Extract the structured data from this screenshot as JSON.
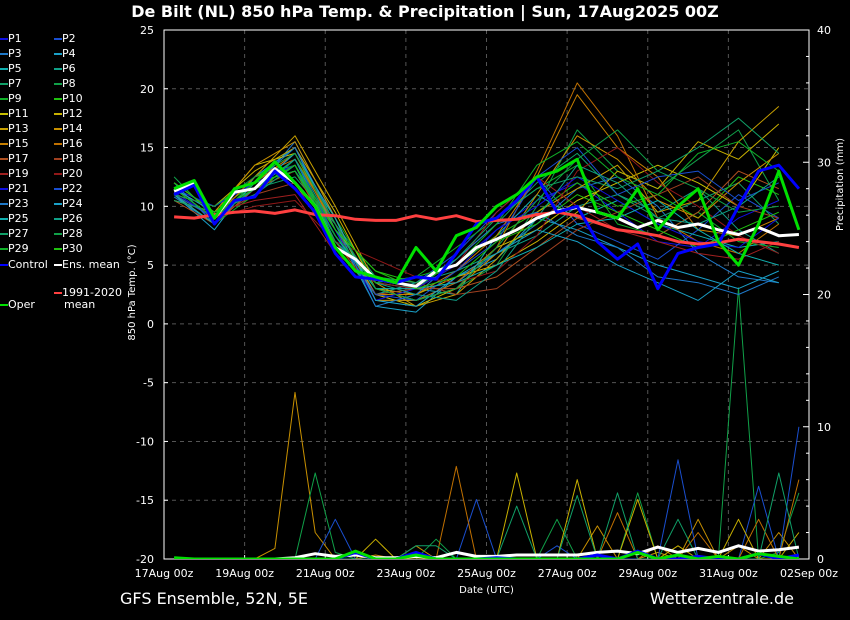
{
  "title": "De Bilt  (NL)  850 hPa Temp. & Precipitation | Sun, 17Aug2025 00Z",
  "footer": {
    "left": "GFS Ensemble, 52N, 5E",
    "right": "Wetterzentrale.de"
  },
  "chart_data": {
    "type": "line",
    "title": "De Bilt  (NL)  850 hPa Temp. & Precipitation | Sun, 17Aug2025 00Z",
    "xlabel": "Date (UTC)",
    "ylabel": "850 hPa Temp. (°C)",
    "y2label": "Precipitation (mm)",
    "ylim": [
      -20,
      25
    ],
    "y2lim": [
      0,
      40
    ],
    "yticks": [
      "25",
      "20",
      "15",
      "10",
      "5",
      "0",
      "-5",
      "-10",
      "-15",
      "-20"
    ],
    "y2ticks": [
      "40",
      "30",
      "20",
      "10",
      "0"
    ],
    "xticks": [
      "17Aug 00z",
      "19Aug 00z",
      "21Aug 00z",
      "23Aug 00z",
      "25Aug 00z",
      "27Aug 00z",
      "29Aug 00z",
      "31Aug 00z",
      "02Sep 00z"
    ],
    "grid": true,
    "legend_position": "left-outside",
    "x_start": "17Aug2025 06z",
    "main_step_hours": 12,
    "member_step_hours": 24,
    "colors": {
      "control": "#0000ff",
      "mean": "#ffffff",
      "oper": "#00e000",
      "climate": "#ff4040",
      "axis": "#ffffff",
      "grid": "#555555"
    },
    "main_series": [
      {
        "key": "climate",
        "name": "1991-2020 mean",
        "color": "#ff4040",
        "values": [
          9.1,
          9.0,
          9.3,
          9.5,
          9.6,
          9.4,
          9.7,
          9.3,
          9.2,
          8.9,
          8.8,
          8.8,
          9.2,
          8.9,
          9.2,
          8.7,
          8.8,
          8.9,
          9.3,
          9.5,
          9.2,
          8.6,
          8.0,
          7.8,
          7.5,
          7.0,
          6.8,
          6.9,
          7.2,
          7.0,
          6.8,
          6.5
        ]
      },
      {
        "key": "mean",
        "name": "Ens. mean",
        "color": "#ffffff",
        "values": [
          11.3,
          12.0,
          9.0,
          11.2,
          11.5,
          13.2,
          12.0,
          10.0,
          6.5,
          5.5,
          3.8,
          3.5,
          3.2,
          4.5,
          5.0,
          6.5,
          7.2,
          8.0,
          9.0,
          9.6,
          9.9,
          9.5,
          9.0,
          8.2,
          8.8,
          8.2,
          8.5,
          8.0,
          7.6,
          8.2,
          7.5,
          7.6
        ]
      },
      {
        "key": "control",
        "name": "Control",
        "color": "#0000ff",
        "values": [
          11.0,
          11.8,
          8.5,
          10.5,
          10.8,
          13.0,
          11.5,
          9.5,
          6.0,
          4.0,
          3.8,
          3.5,
          4.0,
          3.8,
          6.0,
          8.5,
          9.0,
          10.5,
          12.5,
          9.5,
          10.0,
          7.0,
          5.5,
          6.8,
          3.0,
          6.0,
          6.5,
          6.8,
          10.0,
          13.0,
          13.5,
          11.5
        ]
      },
      {
        "key": "oper",
        "name": "Oper",
        "color": "#00e000",
        "values": [
          11.5,
          12.2,
          9.0,
          11.5,
          12.0,
          13.8,
          12.0,
          10.0,
          6.5,
          4.5,
          4.0,
          3.5,
          6.5,
          4.5,
          7.5,
          8.2,
          10.0,
          11.0,
          12.5,
          13.0,
          14.0,
          9.5,
          9.0,
          11.5,
          8.0,
          10.0,
          11.5,
          7.0,
          5.0,
          8.5,
          13.0,
          8.0
        ]
      }
    ],
    "members": [
      {
        "name": "P1",
        "color": "#1010e0",
        "values": [
          11.2,
          9.0,
          11.0,
          13.5,
          7.5,
          3.0,
          2.5,
          4.5,
          8.0,
          10.5,
          12.0,
          9.5,
          7.0,
          6.5,
          9.0,
          10.5
        ]
      },
      {
        "name": "P2",
        "color": "#1a4fd0",
        "values": [
          11.5,
          9.5,
          12.0,
          13.0,
          8.5,
          2.5,
          3.5,
          6.0,
          9.5,
          12.5,
          8.5,
          7.0,
          5.5,
          8.0,
          11.0,
          9.0
        ]
      },
      {
        "name": "P3",
        "color": "#1e78c8",
        "values": [
          10.8,
          8.5,
          11.5,
          15.5,
          9.0,
          2.0,
          2.0,
          3.5,
          6.0,
          8.5,
          11.5,
          12.5,
          10.0,
          6.0,
          4.0,
          3.5
        ]
      },
      {
        "name": "P4",
        "color": "#1aa0c8",
        "values": [
          11.0,
          8.0,
          12.5,
          15.0,
          8.0,
          1.5,
          1.0,
          4.0,
          5.5,
          9.0,
          8.0,
          6.5,
          5.0,
          4.0,
          3.0,
          4.5
        ]
      },
      {
        "name": "P5",
        "color": "#10b0b0",
        "values": [
          12.0,
          9.5,
          11.0,
          14.0,
          7.0,
          3.5,
          3.0,
          2.5,
          7.5,
          11.0,
          9.0,
          10.5,
          8.5,
          7.5,
          6.5,
          7.0
        ]
      },
      {
        "name": "P6",
        "color": "#10a088",
        "values": [
          11.5,
          10.0,
          12.0,
          13.5,
          6.5,
          2.5,
          3.5,
          4.5,
          6.0,
          7.5,
          10.0,
          11.0,
          9.5,
          11.5,
          8.0,
          6.0
        ]
      },
      {
        "name": "P7",
        "color": "#10a068",
        "values": [
          11.0,
          9.0,
          11.5,
          12.5,
          8.5,
          4.0,
          3.0,
          5.5,
          8.5,
          12.0,
          14.5,
          11.0,
          9.0,
          10.5,
          12.0,
          8.5
        ]
      },
      {
        "name": "P8",
        "color": "#10a048",
        "values": [
          12.5,
          9.0,
          12.5,
          13.5,
          7.5,
          3.0,
          2.0,
          3.0,
          5.0,
          10.0,
          16.5,
          13.0,
          11.5,
          14.0,
          16.5,
          10.5
        ]
      },
      {
        "name": "P9",
        "color": "#10b028",
        "values": [
          11.0,
          8.5,
          11.0,
          14.0,
          9.0,
          3.5,
          4.0,
          6.5,
          9.0,
          11.5,
          13.5,
          8.5,
          7.5,
          9.5,
          7.0,
          6.5
        ]
      },
      {
        "name": "P10",
        "color": "#20c010",
        "values": [
          11.5,
          9.5,
          12.0,
          13.0,
          8.0,
          4.5,
          3.5,
          5.0,
          7.5,
          9.5,
          12.0,
          10.0,
          11.0,
          9.0,
          12.5,
          11.0
        ]
      },
      {
        "name": "P11",
        "color": "#c8c000",
        "values": [
          10.5,
          9.5,
          13.5,
          14.5,
          8.5,
          2.5,
          1.5,
          3.0,
          6.5,
          8.0,
          10.5,
          12.0,
          13.5,
          12.0,
          10.0,
          15.0
        ]
      },
      {
        "name": "P12",
        "color": "#c8b000",
        "values": [
          11.0,
          10.0,
          13.0,
          15.0,
          9.5,
          3.0,
          2.5,
          4.0,
          5.0,
          7.0,
          9.5,
          13.0,
          11.5,
          15.5,
          14.0,
          17.0
        ]
      },
      {
        "name": "P13",
        "color": "#c8a000",
        "values": [
          11.5,
          9.0,
          12.5,
          16.0,
          10.0,
          3.5,
          1.5,
          2.5,
          5.5,
          9.5,
          11.5,
          13.5,
          9.5,
          10.5,
          15.5,
          18.5
        ]
      },
      {
        "name": "P14",
        "color": "#c89000",
        "values": [
          12.0,
          9.5,
          13.5,
          15.5,
          9.0,
          2.0,
          2.0,
          3.0,
          6.0,
          11.0,
          16.0,
          14.0,
          10.5,
          9.0,
          12.0,
          14.5
        ]
      },
      {
        "name": "P15",
        "color": "#c88000",
        "values": [
          11.0,
          8.5,
          12.0,
          14.5,
          8.0,
          2.5,
          2.5,
          4.5,
          7.5,
          12.5,
          19.5,
          15.0,
          12.5,
          8.0,
          7.5,
          9.0
        ]
      },
      {
        "name": "P16",
        "color": "#c07000",
        "values": [
          11.5,
          9.0,
          12.5,
          14.0,
          8.5,
          3.0,
          2.0,
          3.5,
          6.5,
          13.0,
          20.5,
          16.0,
          9.0,
          7.0,
          6.0,
          8.5
        ]
      },
      {
        "name": "P17",
        "color": "#b05020",
        "values": [
          10.5,
          8.5,
          11.5,
          13.0,
          7.0,
          2.5,
          3.0,
          3.0,
          4.0,
          6.5,
          9.0,
          8.0,
          7.5,
          9.5,
          13.0,
          11.5
        ]
      },
      {
        "name": "P18",
        "color": "#a04020",
        "values": [
          11.0,
          9.0,
          11.0,
          12.0,
          6.5,
          4.0,
          3.5,
          2.5,
          3.0,
          5.5,
          8.0,
          9.5,
          11.0,
          12.5,
          10.0,
          9.0
        ]
      },
      {
        "name": "P19",
        "color": "#a02020",
        "values": [
          11.5,
          9.5,
          10.5,
          11.0,
          6.0,
          3.5,
          3.0,
          5.0,
          9.5,
          12.5,
          10.0,
          8.0,
          7.0,
          6.0,
          5.5,
          7.0
        ]
      },
      {
        "name": "P20",
        "color": "#901818",
        "values": [
          11.0,
          9.0,
          10.0,
          10.5,
          7.0,
          5.5,
          4.0,
          3.5,
          4.5,
          7.5,
          13.0,
          15.0,
          12.0,
          10.0,
          7.5,
          6.0
        ]
      },
      {
        "name": "P21",
        "color": "#1010e0",
        "values": [
          11.5,
          10.0,
          12.0,
          13.5,
          8.0,
          2.0,
          3.0,
          5.0,
          8.0,
          10.0,
          12.5,
          10.5,
          8.5,
          7.0,
          6.5,
          9.0
        ]
      },
      {
        "name": "P22",
        "color": "#1a4fd0",
        "values": [
          11.0,
          9.0,
          11.5,
          14.0,
          7.5,
          2.5,
          2.0,
          4.5,
          7.0,
          12.5,
          15.0,
          11.0,
          12.5,
          13.0,
          10.5,
          12.0
        ]
      },
      {
        "name": "P23",
        "color": "#1e78c8",
        "values": [
          12.0,
          8.5,
          12.0,
          15.0,
          8.5,
          1.5,
          2.5,
          5.5,
          8.5,
          9.5,
          7.5,
          6.5,
          4.0,
          3.5,
          2.5,
          4.0
        ]
      },
      {
        "name": "P24",
        "color": "#1aa0c8",
        "values": [
          11.5,
          9.5,
          11.5,
          14.5,
          9.0,
          2.0,
          1.5,
          4.0,
          6.0,
          8.0,
          7.0,
          5.0,
          3.5,
          2.0,
          4.5,
          3.5
        ]
      },
      {
        "name": "P25",
        "color": "#10b0b0",
        "values": [
          11.0,
          8.5,
          12.0,
          13.0,
          7.5,
          3.0,
          3.0,
          3.5,
          5.0,
          6.5,
          8.5,
          9.0,
          10.5,
          8.0,
          6.0,
          5.0
        ]
      },
      {
        "name": "P26",
        "color": "#10a088",
        "values": [
          11.5,
          9.0,
          11.5,
          14.0,
          8.0,
          3.5,
          2.5,
          2.0,
          4.5,
          9.0,
          13.5,
          12.0,
          9.0,
          8.5,
          10.0,
          12.5
        ]
      },
      {
        "name": "P27",
        "color": "#10a068",
        "values": [
          10.5,
          9.5,
          11.0,
          13.5,
          7.0,
          4.0,
          3.5,
          5.5,
          9.0,
          11.5,
          12.5,
          11.5,
          13.0,
          15.0,
          17.5,
          14.5
        ]
      },
      {
        "name": "P28",
        "color": "#10a048",
        "values": [
          11.0,
          10.0,
          12.5,
          14.5,
          8.5,
          3.0,
          2.0,
          3.0,
          6.5,
          10.5,
          14.0,
          16.5,
          13.0,
          11.5,
          9.5,
          10.0
        ]
      },
      {
        "name": "P29",
        "color": "#10b028",
        "values": [
          11.5,
          9.0,
          12.0,
          13.0,
          7.5,
          3.5,
          4.0,
          5.0,
          8.5,
          13.5,
          15.5,
          12.5,
          11.0,
          14.5,
          15.5,
          13.0
        ]
      },
      {
        "name": "P30",
        "color": "#20c010",
        "values": [
          12.0,
          9.5,
          11.5,
          13.5,
          8.0,
          4.5,
          3.0,
          4.0,
          7.0,
          8.5,
          11.0,
          9.5,
          8.0,
          6.5,
          8.0,
          9.5
        ]
      }
    ],
    "precipitation": [
      {
        "name": "P14",
        "color": "#c89000",
        "values": [
          0,
          0,
          0,
          0,
          0,
          0.8,
          12.6,
          2.0,
          0,
          0,
          0.3,
          0,
          1.0,
          0,
          0,
          0,
          0,
          0,
          0,
          0,
          0,
          2.5,
          0,
          0,
          0.5,
          0,
          3.0,
          0,
          1.0,
          0,
          2.0,
          0
        ]
      },
      {
        "name": "P8",
        "color": "#10a048",
        "values": [
          0,
          0,
          0,
          0,
          0,
          0,
          0,
          6.5,
          0.5,
          0,
          0,
          0,
          0,
          1.5,
          0,
          0,
          0,
          0,
          0,
          3.0,
          0,
          0,
          0,
          5.0,
          0,
          0,
          0,
          0,
          20.5,
          0,
          0.5,
          5.0
        ]
      },
      {
        "name": "P22",
        "color": "#1a4fd0",
        "values": [
          0,
          0,
          0,
          0,
          0,
          0,
          0,
          0,
          3.0,
          0,
          0,
          0,
          0,
          0,
          0,
          4.5,
          0,
          0,
          0,
          1.0,
          0,
          0,
          0,
          0,
          0,
          7.5,
          0,
          0,
          0,
          5.5,
          0,
          10.0
        ]
      },
      {
        "name": "P16",
        "color": "#c07000",
        "values": [
          0,
          0,
          0,
          0,
          0,
          0,
          0,
          0,
          0,
          0,
          0,
          0,
          0,
          0,
          7.0,
          0,
          0,
          0,
          0,
          0,
          0,
          0,
          3.5,
          0,
          1.0,
          0,
          2.0,
          0,
          0,
          3.0,
          0,
          6.0
        ]
      },
      {
        "name": "P12",
        "color": "#c8b000",
        "values": [
          0,
          0,
          0,
          0,
          0,
          0,
          0,
          0,
          0,
          0,
          1.5,
          0,
          0,
          0,
          0,
          0,
          0,
          6.5,
          0,
          0,
          6.0,
          0,
          0,
          4.5,
          0,
          1.0,
          0,
          0,
          3.0,
          0,
          0,
          2.0
        ]
      },
      {
        "name": "P28",
        "color": "#10a068",
        "values": [
          0,
          0,
          0,
          0,
          0,
          0,
          0,
          0,
          0,
          0,
          0,
          0,
          1.0,
          1.0,
          0,
          0,
          0,
          4.0,
          0,
          0,
          4.8,
          0,
          5.0,
          0,
          0,
          3.0,
          0,
          0,
          0,
          0,
          6.5,
          0
        ]
      },
      {
        "name": "Ens. mean",
        "color": "#ffffff",
        "values": [
          0,
          0,
          0,
          0,
          0,
          0,
          0.1,
          0.4,
          0.2,
          0.3,
          0.1,
          0.1,
          0.2,
          0.1,
          0.5,
          0.2,
          0.2,
          0.3,
          0.3,
          0.3,
          0.3,
          0.5,
          0.6,
          0.4,
          0.9,
          0.5,
          0.8,
          0.5,
          1.0,
          0.6,
          0.7,
          0.9
        ]
      },
      {
        "name": "Control",
        "color": "#0000ff",
        "values": [
          0,
          0,
          0,
          0,
          0,
          0,
          0,
          0,
          0,
          0.5,
          0,
          0,
          0.5,
          0,
          0,
          0,
          0.1,
          0,
          0,
          0,
          0,
          0.3,
          0,
          0.6,
          0,
          0,
          0.2,
          0,
          0,
          0.4,
          0,
          0.3
        ]
      },
      {
        "name": "Oper",
        "color": "#00e000",
        "values": [
          0.1,
          0,
          0,
          0,
          0,
          0,
          0,
          0,
          0,
          0.6,
          0,
          0,
          0.3,
          0,
          0,
          0,
          0,
          0,
          0,
          0,
          0,
          0,
          0,
          0.5,
          0,
          0.3,
          0,
          0.2,
          0,
          0.4,
          0.2,
          0
        ]
      }
    ],
    "legend": {
      "members": [
        "P1",
        "P2",
        "P3",
        "P4",
        "P5",
        "P6",
        "P7",
        "P8",
        "P9",
        "P10",
        "P11",
        "P12",
        "P13",
        "P14",
        "P15",
        "P16",
        "P17",
        "P18",
        "P19",
        "P20",
        "P21",
        "P22",
        "P23",
        "P24",
        "P25",
        "P26",
        "P27",
        "P28",
        "P29",
        "P30"
      ],
      "control": "Control",
      "mean": "Ens. mean",
      "climate": [
        "1991-2020",
        "mean"
      ],
      "oper": "Oper"
    }
  }
}
